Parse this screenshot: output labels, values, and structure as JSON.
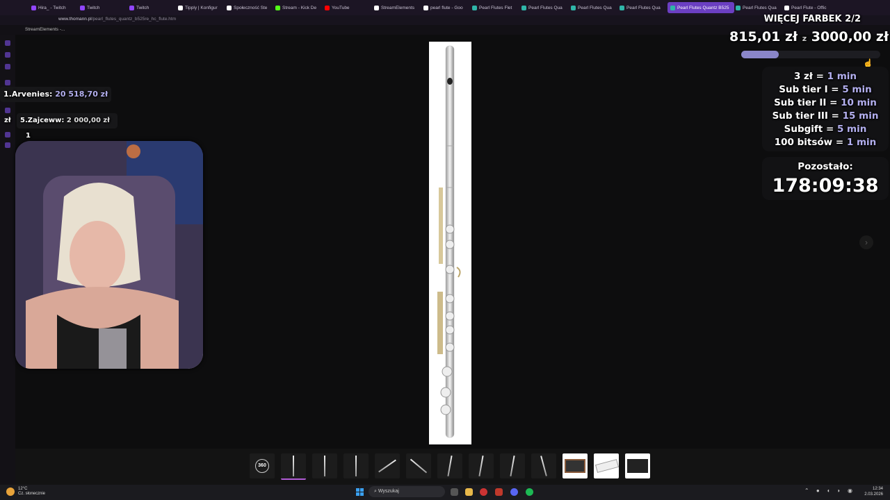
{
  "browser": {
    "tabs": [
      {
        "label": "Hira_ - Twitch",
        "color": "#9146ff"
      },
      {
        "label": "Twitch",
        "color": "#9146ff"
      },
      {
        "label": "Twitch",
        "color": "#9146ff"
      },
      {
        "label": "Tipply | Konfigur",
        "color": "#ffffff"
      },
      {
        "label": "Społeczność Ste",
        "color": "#ffffff"
      },
      {
        "label": "Stream - Kick De",
        "color": "#53fc18"
      },
      {
        "label": "YouTube",
        "color": "#ff0000"
      },
      {
        "label": "StreamElements",
        "color": "#ffffff"
      },
      {
        "label": "pearl flute - Goo",
        "color": "#ffffff"
      },
      {
        "label": "Pearl Flutes Flet",
        "color": "#2fb5a8"
      },
      {
        "label": "Pearl Flutes Qua",
        "color": "#2fb5a8"
      },
      {
        "label": "Pearl Flutes Qua",
        "color": "#2fb5a8"
      },
      {
        "label": "Pearl Flutes Qua",
        "color": "#2fb5a8"
      },
      {
        "label": "Pearl Flutes Quantz B525",
        "color": "#2fb5a8",
        "active": true
      },
      {
        "label": "Pearl Flutes Qua",
        "color": "#2fb5a8"
      },
      {
        "label": "Pearl Flute - Offic",
        "color": "#ffffff"
      }
    ],
    "url_host": "www.thomann.pl",
    "url_path": "/pearl_flutes_quantz_b525re_hc_flute.htm",
    "bookmark": "StreamElements -..."
  },
  "overlay": {
    "goal": {
      "title": "WIĘCEJ FARBEK 2/2",
      "current": "815,01 zł",
      "of": "z",
      "target": "3000,00 zł",
      "progress_fraction": 0.272
    },
    "rules": [
      {
        "left": "3 zł = ",
        "right": "1 min"
      },
      {
        "left": "Sub tier I = ",
        "right": "5 min"
      },
      {
        "left": "Sub tier II = ",
        "right": "10 min"
      },
      {
        "left": "Sub tier III = ",
        "right": "15 min"
      },
      {
        "left": "Subgift = ",
        "right": "5 min"
      },
      {
        "left": "100 bitsów = ",
        "right": "1 min"
      }
    ],
    "timer": {
      "label": "Pozostało:",
      "value": "178:09:38"
    },
    "leaderboard": [
      {
        "rank": "1.",
        "name": "Arvenies:",
        "amount": "20 518,70 zł"
      },
      {
        "rank": "5.",
        "name": "Zajceww:",
        "amount": "2 000,00 zł",
        "suffix": "1"
      }
    ],
    "left_cut": "zł"
  },
  "gallery": {
    "first_thumb_label": "360"
  },
  "taskbar": {
    "weather_temp": "12°C",
    "weather_desc": "Cz. słonecznie",
    "search": "Wyszukaj",
    "time": "12:34",
    "date": "2.03.2026"
  }
}
